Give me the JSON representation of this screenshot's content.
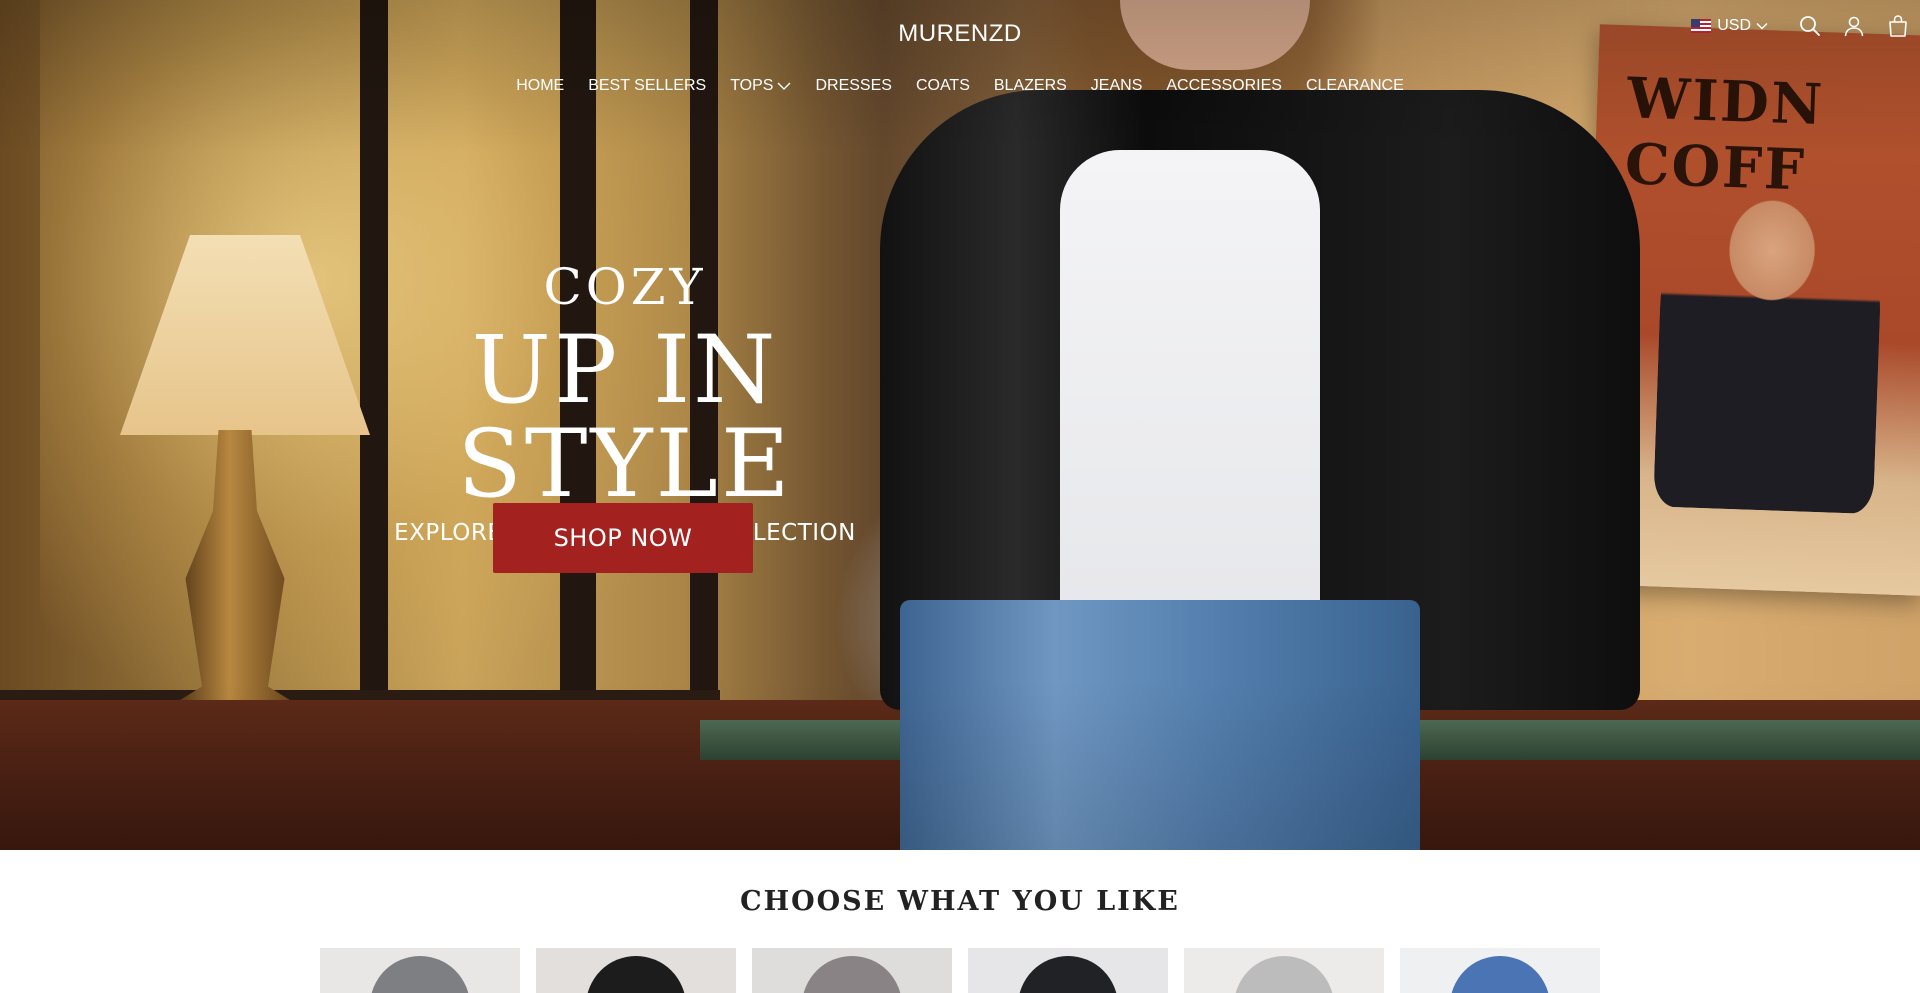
{
  "brand": {
    "name": "MURENZD"
  },
  "nav": {
    "items": [
      {
        "label": "HOME",
        "dropdown": false
      },
      {
        "label": "BEST SELLERS",
        "dropdown": false
      },
      {
        "label": "TOPS",
        "dropdown": true
      },
      {
        "label": "DRESSES",
        "dropdown": false
      },
      {
        "label": "COATS",
        "dropdown": false
      },
      {
        "label": "BLAZERS",
        "dropdown": false
      },
      {
        "label": "JEANS",
        "dropdown": false
      },
      {
        "label": "ACCESSORIES",
        "dropdown": false
      },
      {
        "label": "CLEARANCE",
        "dropdown": false
      }
    ]
  },
  "header": {
    "currency": "USD",
    "icons": [
      "flag-us-icon",
      "search-icon",
      "account-icon",
      "cart-icon"
    ]
  },
  "hero": {
    "line1": "COZY",
    "line2": "UP IN STYLE",
    "subtitle": "EXPLORE OUR KNITWEAR COLLECTION",
    "cta": "SHOP NOW",
    "cta_color": "#a3211f"
  },
  "section": {
    "title": "CHOOSE WHAT YOU LIKE",
    "categories": [
      {
        "bg": "#e9e7e6",
        "fig": "#7d7f83"
      },
      {
        "bg": "#e2dfdc",
        "fig": "#1d1c1d"
      },
      {
        "bg": "#dfdcdc",
        "fig": "#8a8385"
      },
      {
        "bg": "#e6e6e8",
        "fig": "#202226"
      },
      {
        "bg": "#ecebea",
        "fig": "#bdbcbc"
      },
      {
        "bg": "#eef0f2",
        "fig": "#4a74b3"
      }
    ]
  }
}
